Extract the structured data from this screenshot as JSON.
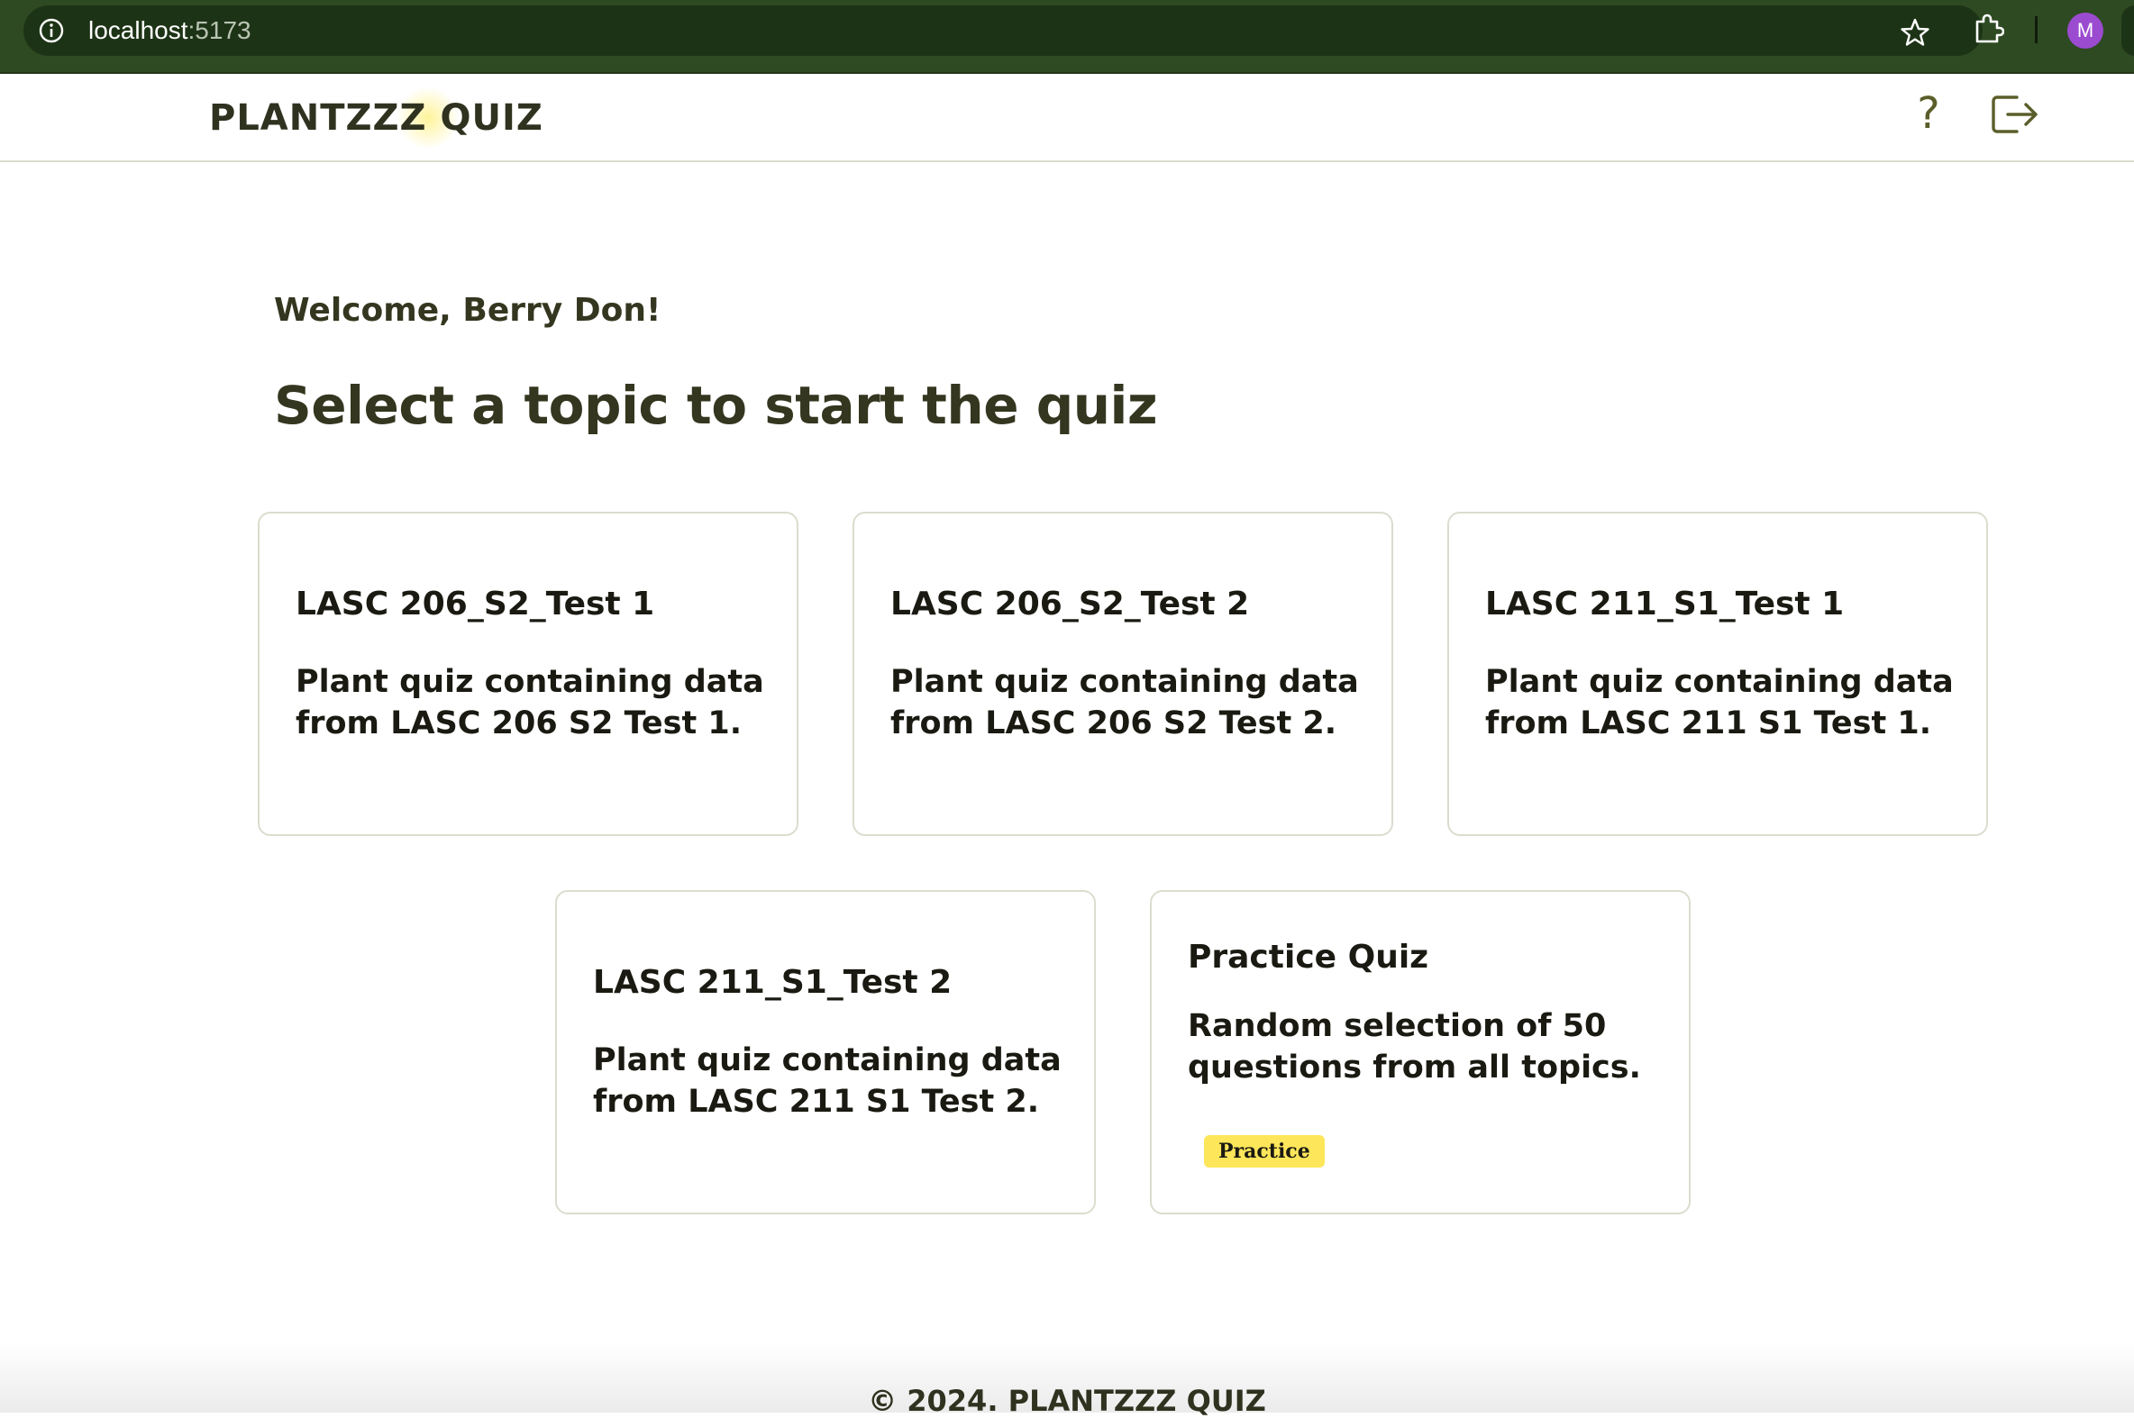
{
  "browser": {
    "url_host": "localhost",
    "url_port": ":5173",
    "profile_initial": "M"
  },
  "header": {
    "logo": "PLANTZZZ QUIZ",
    "help_label": "?"
  },
  "main": {
    "welcome": "Welcome, Berry Don!",
    "title": "Select a topic to start the quiz",
    "topics": [
      {
        "title": "LASC 206_S2_Test 1",
        "description": "Plant quiz containing data from LASC 206 S2 Test 1."
      },
      {
        "title": "LASC 206_S2_Test 2",
        "description": "Plant quiz containing data from LASC 206 S2 Test 2."
      },
      {
        "title": "LASC 211_S1_Test 1",
        "description": "Plant quiz containing data from LASC 211 S1 Test 1."
      },
      {
        "title": "LASC 211_S1_Test 2",
        "description": "Plant quiz containing data from LASC 211 S1 Test 2."
      },
      {
        "title": "Practice Quiz",
        "description": "Random selection of 50 questions from all topics.",
        "badge": "Practice"
      }
    ]
  },
  "footer": {
    "text": "© 2024. PLANTZZZ QUIZ"
  },
  "colors": {
    "chrome_bg": "#2e4a22",
    "brand_text": "#34361f",
    "icon_olive": "#5b5e2a",
    "card_border": "#dcdccf",
    "badge_yellow": "#fde65a",
    "avatar_purple": "#9b4bd0"
  },
  "icons": [
    "info-icon",
    "star-icon",
    "extensions-icon",
    "help-icon",
    "logout-icon"
  ]
}
